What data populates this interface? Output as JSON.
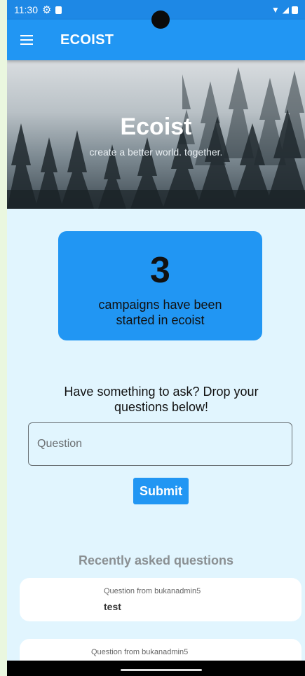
{
  "status_bar": {
    "time": "11:30"
  },
  "app_bar": {
    "title": "ECOIST"
  },
  "hero": {
    "title": "Ecoist",
    "subtitle": "create a better world. together."
  },
  "stats": {
    "count": "3",
    "text": "campaigns have been started in ecoist"
  },
  "ask": {
    "label": "Have something to ask? Drop your questions below!",
    "placeholder": "Question",
    "submit_label": "Submit"
  },
  "recent": {
    "title": "Recently asked questions",
    "questions": [
      {
        "meta": "Question from bukanadmin5",
        "text": "test"
      },
      {
        "meta": "Question from bukanadmin5",
        "text": ""
      }
    ]
  },
  "colors": {
    "primary": "#2196f3",
    "status_bar": "#1e88e5",
    "background": "#e1f5fe"
  }
}
